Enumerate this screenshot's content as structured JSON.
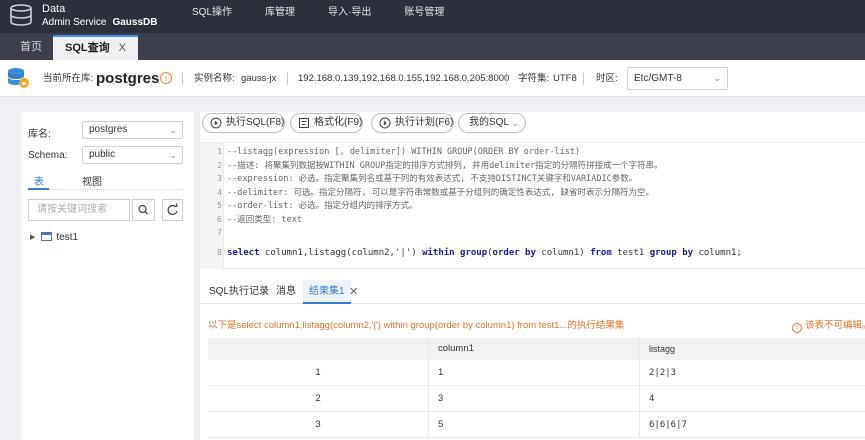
{
  "topbar": {
    "logo_line1": "Data",
    "logo_line2": "Admin Service",
    "logo_brand": "GaussDB",
    "nav": [
      "SQL操作",
      "库管理",
      "导入·导出",
      "账号管理"
    ]
  },
  "tabs": {
    "home": "首页",
    "sql": "SQL查询",
    "close": "X"
  },
  "infobar": {
    "current_db_label": "当前所在库:",
    "current_db": "postgres",
    "instance_label": "实例名称:",
    "instance_name": "gauss-jx",
    "ips": "192.168.0.139,192.168.0.155,192.168.0.205:8000",
    "charset_label": "字符集:",
    "charset": "UTF8",
    "timezone_label": "时区:",
    "timezone": "Etc/GMT-8",
    "warn_glyph": "i"
  },
  "leftpanel": {
    "db_label": "库名:",
    "db_value": "postgres",
    "schema_label": "Schema:",
    "schema_value": "public",
    "tab_table": "表",
    "tab_view": "视图",
    "search_placeholder": "请按关键词搜索",
    "tree_item": "test1"
  },
  "toolbar": {
    "execute": "执行SQL(F8)",
    "format": "格式化(F9)",
    "plan": "执行计划(F6)",
    "my_sql": "我的SQL"
  },
  "editor": {
    "lines": [
      {
        "n": "1",
        "text": "--listagg(expression [, delimiter]) WITHIN GROUP(ORDER BY order-list)"
      },
      {
        "n": "2",
        "text": "--描述: 将聚集列数据按WITHIN GROUP指定的排序方式排列, 并用delimiter指定的分隔符拼接成一个字符串。"
      },
      {
        "n": "3",
        "text": "--expression: 必选。指定聚集列名或基于列的有效表达式, 不支持DISTINCT关键字和VARIADIC参数。"
      },
      {
        "n": "4",
        "text": "--delimiter: 可选。指定分隔符, 可以是字符串常数或基于分组列的确定性表达式, 缺省时表示分隔符为空。"
      },
      {
        "n": "5",
        "text": "--order-list: 必选。指定分组内的排序方式。"
      },
      {
        "n": "6",
        "text": "--返回类型: text"
      },
      {
        "n": "7",
        "text": ""
      }
    ],
    "sql_line_number": "8",
    "sql": {
      "select": "select",
      "cols": "  column1,listagg(column2,",
      "str": "'|'",
      "p1": ") ",
      "within": "within group",
      "p2": "(",
      "order": "order by",
      "p3": " column1) ",
      "from": "from",
      "p4": " test1 ",
      "group": "group by",
      "p5": " column1;"
    }
  },
  "results": {
    "tabs": [
      "SQL执行记录",
      "消息",
      "结果集1"
    ],
    "close": "✕",
    "info": "以下是select column1,listagg(column2,'|') within group(order by column1) from test1...的执行结果集",
    "warn": "该表不可编辑。",
    "headers": [
      "",
      "column1",
      "listagg"
    ],
    "rows": [
      [
        "1",
        "1",
        "2|2|3"
      ],
      [
        "2",
        "3",
        "4"
      ],
      [
        "3",
        "5",
        "6|6|6|7"
      ]
    ]
  }
}
